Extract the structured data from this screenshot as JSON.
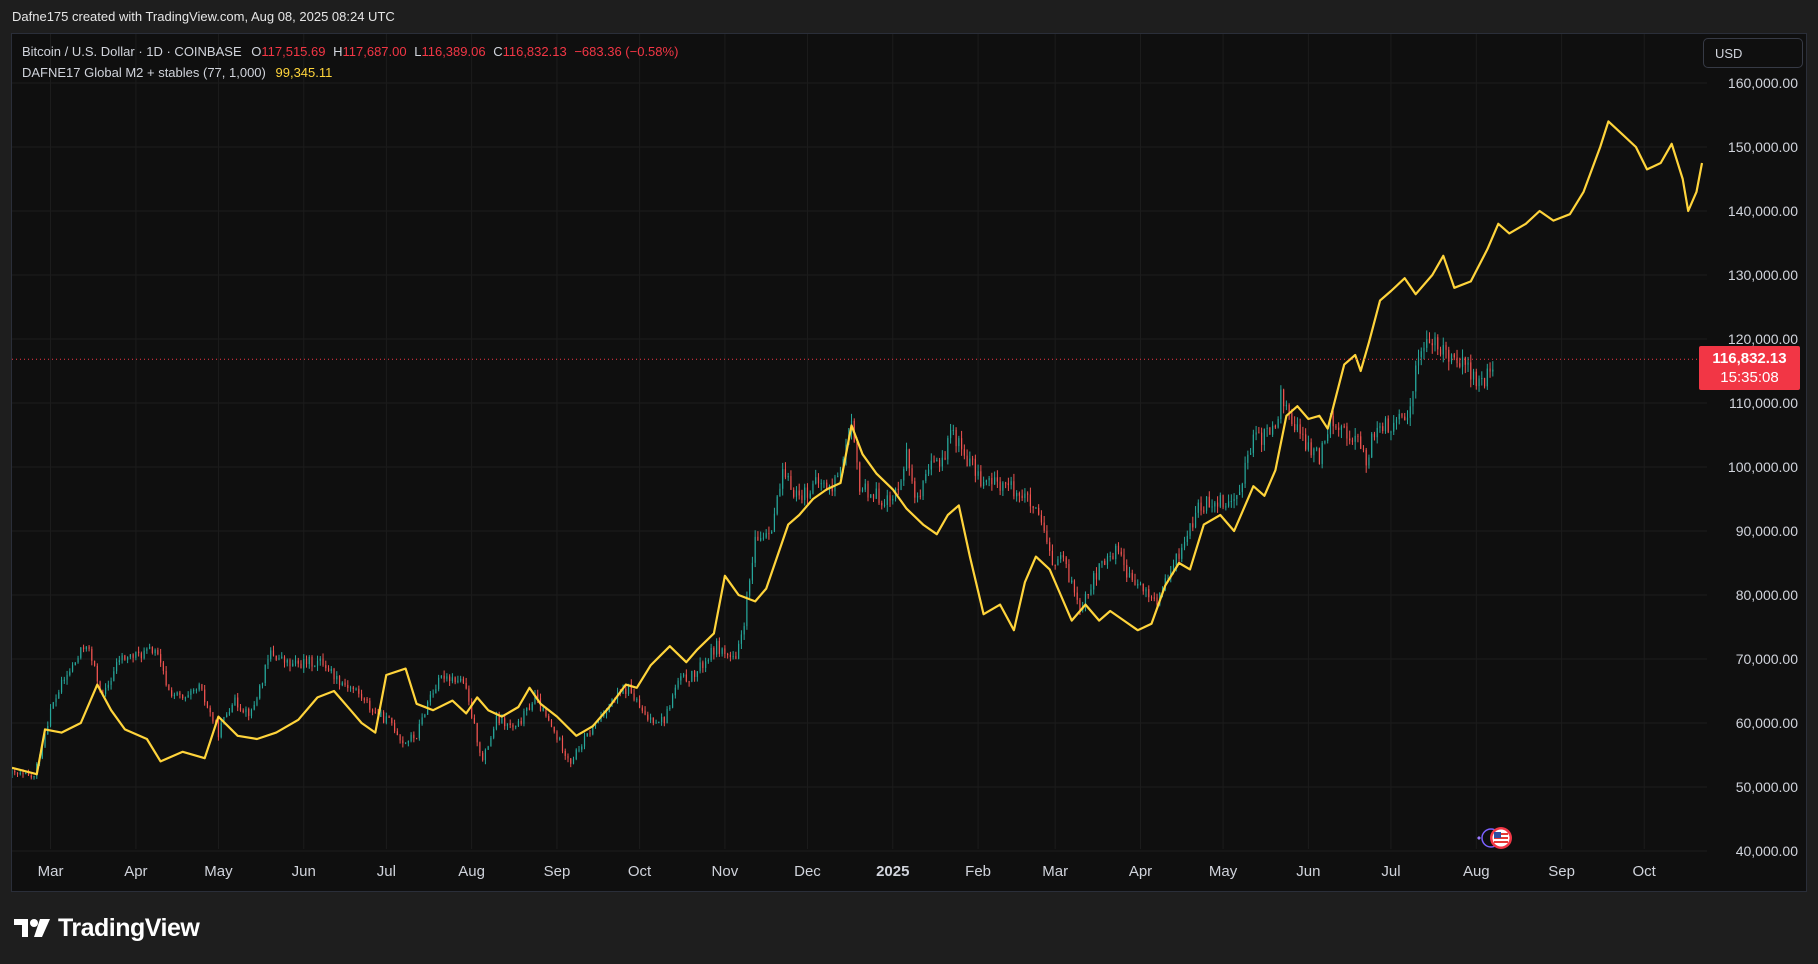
{
  "header": {
    "attribution": "Dafne175 created with TradingView.com, Aug 08, 2025 08:24 UTC"
  },
  "legend": {
    "symbol": "Bitcoin / U.S. Dollar · 1D · COINBASE",
    "o_key": "O",
    "o_val": "117,515.69",
    "h_key": "H",
    "h_val": "117,687.00",
    "l_key": "L",
    "l_val": "116,389.06",
    "c_key": "C",
    "c_val": "116,832.13",
    "change": "−683.36 (−0.58%)",
    "indicator_name": "DAFNE17 Global M2 + stables (77, 1,000)",
    "indicator_val": "99,345.11"
  },
  "currency_button": {
    "label": "USD"
  },
  "price_badge": {
    "price": "116,832.13",
    "countdown": "15:35:08"
  },
  "footer": {
    "brand": "TradingView"
  },
  "colors": {
    "up": "#26a69a",
    "down": "#ef5350",
    "m2_line": "#ffd43b",
    "price_badge": "#f23645",
    "background": "#0f0f0f",
    "grid": "#1c1c1c"
  },
  "icons": [
    "tradingview-logo-icon",
    "event-flag-us-icon",
    "event-star-icon"
  ],
  "chart_data": {
    "type": "line",
    "title": "",
    "xlabel": "",
    "ylabel": "",
    "ylim": [
      40000,
      160000
    ],
    "grid": true,
    "y_ticks": [
      "160,000.00",
      "150,000.00",
      "140,000.00",
      "130,000.00",
      "120,000.00",
      "110,000.00",
      "100,000.00",
      "90,000.00",
      "80,000.00",
      "70,000.00",
      "60,000.00",
      "50,000.00",
      "40,000.00"
    ],
    "y_tick_values": [
      160000,
      150000,
      140000,
      130000,
      120000,
      110000,
      100000,
      90000,
      80000,
      70000,
      60000,
      50000,
      40000
    ],
    "x_ticks": [
      "Mar",
      "Apr",
      "May",
      "Jun",
      "Jul",
      "Aug",
      "Sep",
      "Oct",
      "Nov",
      "Dec",
      "2025",
      "Feb",
      "Mar",
      "Apr",
      "May",
      "Jun",
      "Jul",
      "Aug",
      "Sep",
      "Oct"
    ],
    "x_tick_dates": [
      "2024-03-01",
      "2024-04-01",
      "2024-05-01",
      "2024-06-01",
      "2024-07-01",
      "2024-08-01",
      "2024-09-01",
      "2024-10-01",
      "2024-11-01",
      "2024-12-01",
      "2025-01-01",
      "2025-02-01",
      "2025-03-01",
      "2025-04-01",
      "2025-05-01",
      "2025-06-01",
      "2025-07-01",
      "2025-08-01",
      "2025-09-01",
      "2025-10-01"
    ],
    "x_range": [
      "2024-02-16",
      "2025-10-22"
    ],
    "last_price": 116832.13,
    "series": [
      {
        "type": "candlestick",
        "points": [
          [
            "2024-02-16",
            52000
          ],
          [
            "2024-02-24",
            51500
          ],
          [
            "2024-03-01",
            62000
          ],
          [
            "2024-03-05",
            66000
          ],
          [
            "2024-03-10",
            69500
          ],
          [
            "2024-03-14",
            72500
          ],
          [
            "2024-03-20",
            64000
          ],
          [
            "2024-03-26",
            70000
          ],
          [
            "2024-04-01",
            70500
          ],
          [
            "2024-04-08",
            71500
          ],
          [
            "2024-04-13",
            65000
          ],
          [
            "2024-04-19",
            63500
          ],
          [
            "2024-04-24",
            65500
          ],
          [
            "2024-05-01",
            58500
          ],
          [
            "2024-05-06",
            63500
          ],
          [
            "2024-05-13",
            61500
          ],
          [
            "2024-05-20",
            71000
          ],
          [
            "2024-05-27",
            69000
          ],
          [
            "2024-06-03",
            69500
          ],
          [
            "2024-06-08",
            69500
          ],
          [
            "2024-06-13",
            67000
          ],
          [
            "2024-06-20",
            65000
          ],
          [
            "2024-06-27",
            61500
          ],
          [
            "2024-07-03",
            60000
          ],
          [
            "2024-07-07",
            57000
          ],
          [
            "2024-07-12",
            58000
          ],
          [
            "2024-07-17",
            64500
          ],
          [
            "2024-07-22",
            67500
          ],
          [
            "2024-07-29",
            66500
          ],
          [
            "2024-08-05",
            54000
          ],
          [
            "2024-08-10",
            60500
          ],
          [
            "2024-08-17",
            59000
          ],
          [
            "2024-08-24",
            64000
          ],
          [
            "2024-08-31",
            58500
          ],
          [
            "2024-09-06",
            54000
          ],
          [
            "2024-09-12",
            58000
          ],
          [
            "2024-09-20",
            63000
          ],
          [
            "2024-09-27",
            65500
          ],
          [
            "2024-10-03",
            60800
          ],
          [
            "2024-10-10",
            60500
          ],
          [
            "2024-10-15",
            66500
          ],
          [
            "2024-10-21",
            67500
          ],
          [
            "2024-10-29",
            72000
          ],
          [
            "2024-11-05",
            69500
          ],
          [
            "2024-11-08",
            76000
          ],
          [
            "2024-11-12",
            88000
          ],
          [
            "2024-11-18",
            91000
          ],
          [
            "2024-11-22",
            98500
          ],
          [
            "2024-11-28",
            95500
          ],
          [
            "2024-12-05",
            97500
          ],
          [
            "2024-12-10",
            96500
          ],
          [
            "2024-12-17",
            106000
          ],
          [
            "2024-12-20",
            97000
          ],
          [
            "2024-12-26",
            95500
          ],
          [
            "2025-01-01",
            94500
          ],
          [
            "2025-01-06",
            102000
          ],
          [
            "2025-01-10",
            94500
          ],
          [
            "2025-01-15",
            100000
          ],
          [
            "2025-01-20",
            102000
          ],
          [
            "2025-01-22",
            106000
          ],
          [
            "2025-01-27",
            102000
          ],
          [
            "2025-02-03",
            97500
          ],
          [
            "2025-02-10",
            97500
          ],
          [
            "2025-02-18",
            95500
          ],
          [
            "2025-02-24",
            91000
          ],
          [
            "2025-02-28",
            84500
          ],
          [
            "2025-03-03",
            86000
          ],
          [
            "2025-03-10",
            78500
          ],
          [
            "2025-03-17",
            84000
          ],
          [
            "2025-03-24",
            87500
          ],
          [
            "2025-03-28",
            82500
          ],
          [
            "2025-04-07",
            79000
          ],
          [
            "2025-04-13",
            84500
          ],
          [
            "2025-04-22",
            93500
          ],
          [
            "2025-04-28",
            95000
          ],
          [
            "2025-05-05",
            94500
          ],
          [
            "2025-05-12",
            104000
          ],
          [
            "2025-05-20",
            106000
          ],
          [
            "2025-05-22",
            111000
          ],
          [
            "2025-05-30",
            104000
          ],
          [
            "2025-06-05",
            101500
          ],
          [
            "2025-06-09",
            108000
          ],
          [
            "2025-06-14",
            105500
          ],
          [
            "2025-06-18",
            104500
          ],
          [
            "2025-06-22",
            101000
          ],
          [
            "2025-06-26",
            107000
          ],
          [
            "2025-07-01",
            106000
          ],
          [
            "2025-07-07",
            108000
          ],
          [
            "2025-07-11",
            117500
          ],
          [
            "2025-07-14",
            119800
          ],
          [
            "2025-07-20",
            118000
          ],
          [
            "2025-07-25",
            117500
          ],
          [
            "2025-08-01",
            113500
          ],
          [
            "2025-08-03",
            112500
          ],
          [
            "2025-08-08",
            116832
          ]
        ]
      },
      {
        "name": "DAFNE17 Global M2 + stables (77, 1,000)",
        "type": "line",
        "points": [
          [
            "2024-02-16",
            53000
          ],
          [
            "2024-02-25",
            52000
          ],
          [
            "2024-02-28",
            59000
          ],
          [
            "2024-03-05",
            58500
          ],
          [
            "2024-03-12",
            60000
          ],
          [
            "2024-03-18",
            66000
          ],
          [
            "2024-03-23",
            62000
          ],
          [
            "2024-03-28",
            59000
          ],
          [
            "2024-04-05",
            57500
          ],
          [
            "2024-04-10",
            54000
          ],
          [
            "2024-04-18",
            55500
          ],
          [
            "2024-04-26",
            54500
          ],
          [
            "2024-05-01",
            61000
          ],
          [
            "2024-05-08",
            58000
          ],
          [
            "2024-05-15",
            57500
          ],
          [
            "2024-05-22",
            58500
          ],
          [
            "2024-05-30",
            60500
          ],
          [
            "2024-06-06",
            64000
          ],
          [
            "2024-06-12",
            65000
          ],
          [
            "2024-06-18",
            62000
          ],
          [
            "2024-06-22",
            60000
          ],
          [
            "2024-06-27",
            58500
          ],
          [
            "2024-07-01",
            67500
          ],
          [
            "2024-07-08",
            68500
          ],
          [
            "2024-07-12",
            63000
          ],
          [
            "2024-07-18",
            62000
          ],
          [
            "2024-07-25",
            63500
          ],
          [
            "2024-07-30",
            61500
          ],
          [
            "2024-08-03",
            64000
          ],
          [
            "2024-08-07",
            62000
          ],
          [
            "2024-08-12",
            61000
          ],
          [
            "2024-08-18",
            62500
          ],
          [
            "2024-08-22",
            65500
          ],
          [
            "2024-08-26",
            63000
          ],
          [
            "2024-09-01",
            61000
          ],
          [
            "2024-09-08",
            58000
          ],
          [
            "2024-09-14",
            59500
          ],
          [
            "2024-09-20",
            62500
          ],
          [
            "2024-09-26",
            66000
          ],
          [
            "2024-09-30",
            65500
          ],
          [
            "2024-10-05",
            69000
          ],
          [
            "2024-10-12",
            72000
          ],
          [
            "2024-10-18",
            69500
          ],
          [
            "2024-10-22",
            71500
          ],
          [
            "2024-10-28",
            74000
          ],
          [
            "2024-11-01",
            83000
          ],
          [
            "2024-11-06",
            80000
          ],
          [
            "2024-11-12",
            79000
          ],
          [
            "2024-11-16",
            81000
          ],
          [
            "2024-11-20",
            86000
          ],
          [
            "2024-11-24",
            91000
          ],
          [
            "2024-11-28",
            92500
          ],
          [
            "2024-12-03",
            95000
          ],
          [
            "2024-12-08",
            96500
          ],
          [
            "2024-12-13",
            97500
          ],
          [
            "2024-12-17",
            106500
          ],
          [
            "2024-12-21",
            102000
          ],
          [
            "2024-12-26",
            99000
          ],
          [
            "2025-01-01",
            96500
          ],
          [
            "2025-01-06",
            93500
          ],
          [
            "2025-01-12",
            91000
          ],
          [
            "2025-01-17",
            89500
          ],
          [
            "2025-01-21",
            92500
          ],
          [
            "2025-01-25",
            94000
          ],
          [
            "2025-01-29",
            86000
          ],
          [
            "2025-02-03",
            77000
          ],
          [
            "2025-02-09",
            78500
          ],
          [
            "2025-02-14",
            74500
          ],
          [
            "2025-02-18",
            82000
          ],
          [
            "2025-02-22",
            86000
          ],
          [
            "2025-02-27",
            84000
          ],
          [
            "2025-03-03",
            80000
          ],
          [
            "2025-03-07",
            76000
          ],
          [
            "2025-03-12",
            78500
          ],
          [
            "2025-03-17",
            76000
          ],
          [
            "2025-03-21",
            77500
          ],
          [
            "2025-03-26",
            76000
          ],
          [
            "2025-03-31",
            74500
          ],
          [
            "2025-04-05",
            75500
          ],
          [
            "2025-04-10",
            81500
          ],
          [
            "2025-04-15",
            85000
          ],
          [
            "2025-04-19",
            84000
          ],
          [
            "2025-04-24",
            91000
          ],
          [
            "2025-04-30",
            92500
          ],
          [
            "2025-05-05",
            90000
          ],
          [
            "2025-05-12",
            97000
          ],
          [
            "2025-05-16",
            95500
          ],
          [
            "2025-05-20",
            99500
          ],
          [
            "2025-05-24",
            108000
          ],
          [
            "2025-05-28",
            109500
          ],
          [
            "2025-06-01",
            107500
          ],
          [
            "2025-06-05",
            108000
          ],
          [
            "2025-06-08",
            106000
          ],
          [
            "2025-06-14",
            116000
          ],
          [
            "2025-06-18",
            117500
          ],
          [
            "2025-06-20",
            115000
          ],
          [
            "2025-06-23",
            119500
          ],
          [
            "2025-06-27",
            126000
          ],
          [
            "2025-07-01",
            127500
          ],
          [
            "2025-07-06",
            129500
          ],
          [
            "2025-07-10",
            127000
          ],
          [
            "2025-07-16",
            130000
          ],
          [
            "2025-07-20",
            133000
          ],
          [
            "2025-07-24",
            128000
          ],
          [
            "2025-07-30",
            129000
          ],
          [
            "2025-08-05",
            134000
          ],
          [
            "2025-08-09",
            138000
          ],
          [
            "2025-08-13",
            136500
          ],
          [
            "2025-08-19",
            138000
          ],
          [
            "2025-08-24",
            140000
          ],
          [
            "2025-08-29",
            138500
          ],
          [
            "2025-09-04",
            139500
          ],
          [
            "2025-09-09",
            143000
          ],
          [
            "2025-09-15",
            150000
          ],
          [
            "2025-09-18",
            154000
          ],
          [
            "2025-09-23",
            152000
          ],
          [
            "2025-09-28",
            150000
          ],
          [
            "2025-10-02",
            146500
          ],
          [
            "2025-10-07",
            147500
          ],
          [
            "2025-10-11",
            150500
          ],
          [
            "2025-10-15",
            145000
          ],
          [
            "2025-10-17",
            140000
          ],
          [
            "2025-10-20",
            143000
          ],
          [
            "2025-10-22",
            147500
          ]
        ]
      }
    ]
  }
}
